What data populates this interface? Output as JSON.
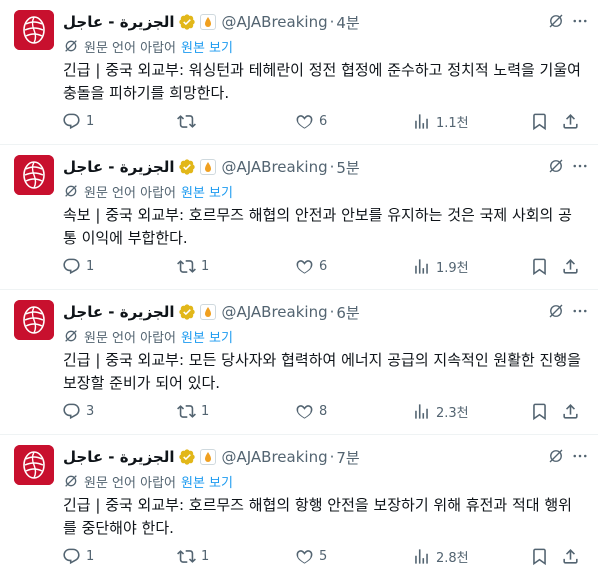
{
  "colors": {
    "brand_red": "#c8102e",
    "verified_gold": "#e2b719",
    "link_blue": "#1d9bf0",
    "muted": "#536471"
  },
  "icons": [
    "aljazeera-logo",
    "verified-badge-icon",
    "affiliate-icon",
    "grok-icon",
    "more-icon",
    "translate-icon",
    "reply-icon",
    "retweet-icon",
    "like-icon",
    "views-icon",
    "bookmark-icon",
    "share-icon"
  ],
  "tweets": [
    {
      "author": "الجزيرة - عاجل",
      "handle": "@AJABreaking",
      "separator": "·",
      "time": "4분",
      "translated_note": "원문 언어 아랍어",
      "show_original": "원본 보기",
      "text": "긴급 | 중국 외교부: 워싱턴과 테헤란이 정전 협정에 준수하고 정치적 노력을 기울여 충돌을 피하기를 희망한다.",
      "replies": "1",
      "retweets": "",
      "likes": "6",
      "views": "1.1천"
    },
    {
      "author": "الجزيرة - عاجل",
      "handle": "@AJABreaking",
      "separator": "·",
      "time": "5분",
      "translated_note": "원문 언어 아랍어",
      "show_original": "원본 보기",
      "text": "속보 | 중국 외교부: 호르무즈 해협의 안전과 안보를 유지하는 것은 국제 사회의 공통 이익에 부합한다.",
      "replies": "1",
      "retweets": "1",
      "likes": "6",
      "views": "1.9천"
    },
    {
      "author": "الجزيرة - عاجل",
      "handle": "@AJABreaking",
      "separator": "·",
      "time": "6분",
      "translated_note": "원문 언어 아랍어",
      "show_original": "원본 보기",
      "text": "긴급 | 중국 외교부: 모든 당사자와 협력하여 에너지 공급의 지속적인 원활한 진행을 보장할 준비가 되어 있다.",
      "replies": "3",
      "retweets": "1",
      "likes": "8",
      "views": "2.3천"
    },
    {
      "author": "الجزيرة - عاجل",
      "handle": "@AJABreaking",
      "separator": "·",
      "time": "7분",
      "translated_note": "원문 언어 아랍어",
      "show_original": "원본 보기",
      "text": "긴급 | 중국 외교부: 호르무즈 해협의 항행 안전을 보장하기 위해 휴전과 적대 행위를 중단해야 한다.",
      "replies": "1",
      "retweets": "1",
      "likes": "5",
      "views": "2.8천"
    }
  ]
}
